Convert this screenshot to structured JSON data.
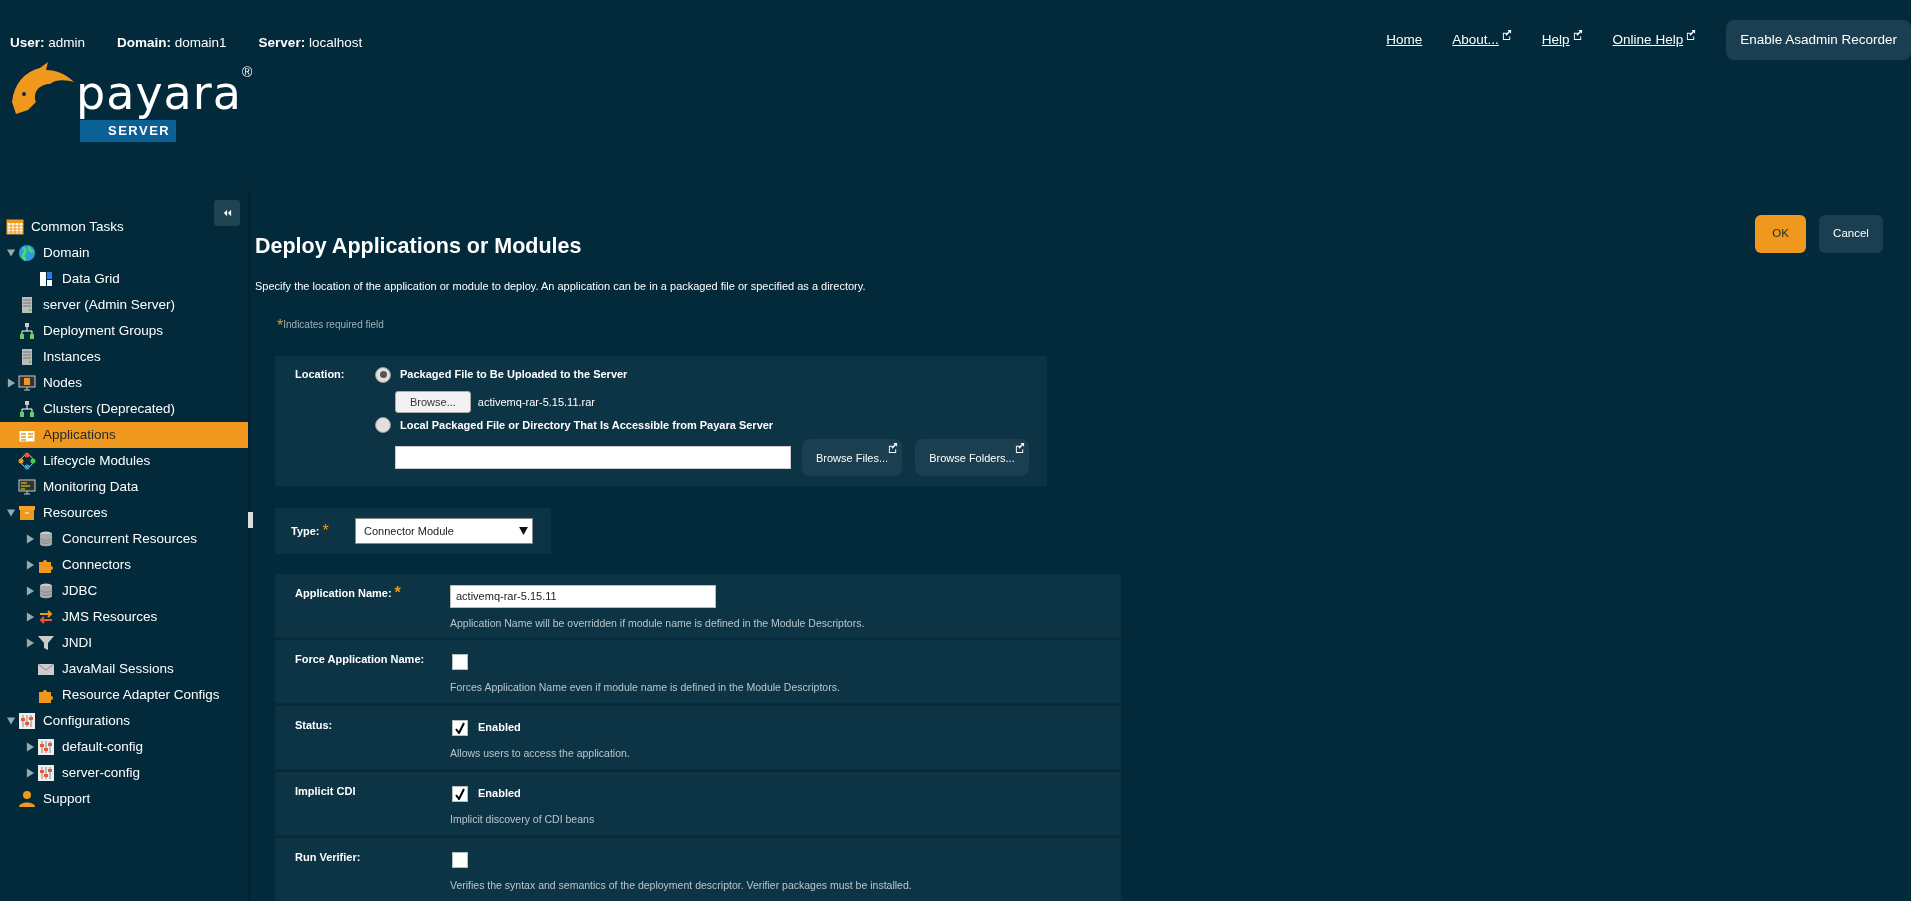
{
  "header": {
    "user_info": [
      {
        "label": "User:",
        "value": "admin"
      },
      {
        "label": "Domain:",
        "value": "domain1"
      },
      {
        "label": "Server:",
        "value": "localhost"
      }
    ],
    "links": [
      {
        "label": "Home",
        "external": false
      },
      {
        "label": "About...",
        "external": true
      },
      {
        "label": "Help",
        "external": true
      },
      {
        "label": "Online Help",
        "external": true
      }
    ],
    "recorder_button": "Enable Asadmin Recorder"
  },
  "logo": {
    "wordmark": "payara",
    "registered": "®",
    "badge": "SERVER"
  },
  "sidebar": {
    "items": [
      {
        "label": "Common Tasks",
        "selected": false
      },
      {
        "label": "Domain",
        "selected": false,
        "expanded": true,
        "children": [
          {
            "label": "Data Grid",
            "selected": false
          }
        ]
      },
      {
        "label": "server (Admin Server)",
        "selected": false
      },
      {
        "label": "Deployment Groups",
        "selected": false
      },
      {
        "label": "Instances",
        "selected": false
      },
      {
        "label": "Nodes",
        "selected": false,
        "expanded": false
      },
      {
        "label": "Clusters (Deprecated)",
        "selected": false
      },
      {
        "label": "Applications",
        "selected": true
      },
      {
        "label": "Lifecycle Modules",
        "selected": false
      },
      {
        "label": "Monitoring Data",
        "selected": false
      },
      {
        "label": "Resources",
        "selected": false,
        "expanded": true,
        "children": [
          {
            "label": "Concurrent Resources",
            "selected": false,
            "expanded": false
          },
          {
            "label": "Connectors",
            "selected": false,
            "expanded": false
          },
          {
            "label": "JDBC",
            "selected": false,
            "expanded": false
          },
          {
            "label": "JMS Resources",
            "selected": false,
            "expanded": false
          },
          {
            "label": "JNDI",
            "selected": false,
            "expanded": false
          },
          {
            "label": "JavaMail Sessions",
            "selected": false
          },
          {
            "label": "Resource Adapter Configs",
            "selected": false
          }
        ]
      },
      {
        "label": "Configurations",
        "selected": false,
        "expanded": true,
        "children": [
          {
            "label": "default-config",
            "selected": false,
            "expanded": false
          },
          {
            "label": "server-config",
            "selected": false,
            "expanded": false
          }
        ]
      },
      {
        "label": "Support",
        "selected": false
      }
    ]
  },
  "page": {
    "title": "Deploy Applications or Modules",
    "ok_button": "OK",
    "cancel_button": "Cancel",
    "description": "Specify the location of the application or module to deploy. An application can be in a packaged file or specified as a directory.",
    "required_note": {
      "mark": "*",
      "text": "Indicates required field"
    }
  },
  "location": {
    "label": "Location:",
    "options": [
      {
        "label": "Packaged File to Be Uploaded to the Server",
        "selected": true
      },
      {
        "label": "Local Packaged File or Directory That Is Accessible from Payara Server",
        "selected": false
      }
    ],
    "browse_button": "Browse...",
    "file_name": "activemq-rar-5.15.11.rar",
    "browse_files_button": "Browse Files...",
    "browse_folders_button": "Browse Folders..."
  },
  "type": {
    "label": "Type:",
    "required_mark": "*",
    "value": "Connector Module"
  },
  "properties": [
    {
      "kind": "text",
      "label": "Application Name:",
      "required_mark": "*",
      "value": "activemq-rar-5.15.11",
      "help": "Application Name will be overridden if module name is defined in the Module Descriptors."
    },
    {
      "kind": "checkbox",
      "label": "Force Application Name:",
      "checked": false,
      "help": "Forces Application Name even if module name is defined in the Module Descriptors."
    },
    {
      "kind": "checkbox",
      "label": "Status:",
      "checked": true,
      "checkbox_label": "Enabled",
      "help": "Allows users to access the application."
    },
    {
      "kind": "checkbox",
      "label": "Implicit CDI",
      "checked": true,
      "checkbox_label": "Enabled",
      "help": "Implicit discovery of CDI beans"
    },
    {
      "kind": "checkbox",
      "label": "Run Verifier:",
      "checked": false,
      "help": "Verifies the syntax and semantics of the deployment descriptor. Verifier packages must be installed."
    }
  ]
}
